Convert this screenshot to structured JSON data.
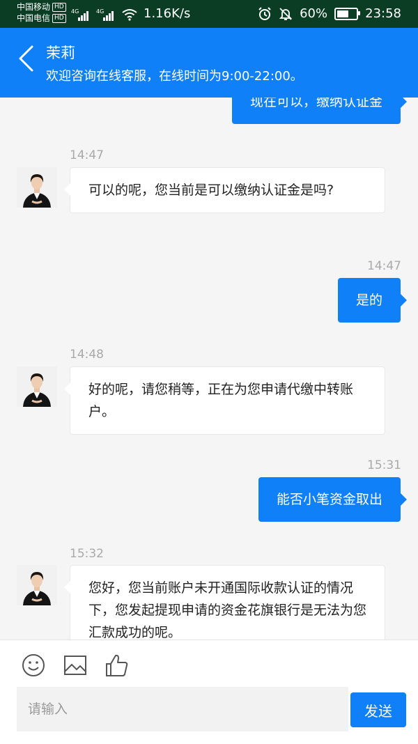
{
  "status_bar": {
    "carrier1": "中国移动",
    "carrier2": "中国电信",
    "hd": "HD",
    "network": "4G",
    "speed": "1.16K/s",
    "battery": "60%",
    "battery_level": 0.6,
    "time": "23:58"
  },
  "header": {
    "title": "茉莉",
    "subtitle": "欢迎咨询在线客服，在线时间为9:00-22:00。"
  },
  "messages": [
    {
      "sender": "user",
      "time": "",
      "text": "现在可以，缴纳认证金"
    },
    {
      "sender": "agent",
      "time": "14:47",
      "text": "可以的呢，您当前是可以缴纳认证金是吗?"
    },
    {
      "sender": "user",
      "time": "14:47",
      "text": "是的"
    },
    {
      "sender": "agent",
      "time": "14:48",
      "text": "好的呢，请您稍等，正在为您申请代缴中转账户。"
    },
    {
      "sender": "user",
      "time": "15:31",
      "text": "能否小笔资金取出"
    },
    {
      "sender": "agent",
      "time": "15:32",
      "text": "您好，您当前账户未开通国际收款认证的情况下，您发起提现申请的资金花旗银行是无法为您汇款成功的呢。"
    }
  ],
  "input": {
    "placeholder": "请输入",
    "value": "",
    "send_label": "发送"
  },
  "icons": [
    "back-arrow-icon",
    "emoji-icon",
    "image-icon",
    "thumbs-up-icon",
    "alarm-icon",
    "bell-off-icon",
    "wifi-icon",
    "signal-icon",
    "battery-icon"
  ],
  "colors": {
    "accent": "#1080f8",
    "status_bar": "#0a3d24",
    "background": "#f5f5f5"
  }
}
